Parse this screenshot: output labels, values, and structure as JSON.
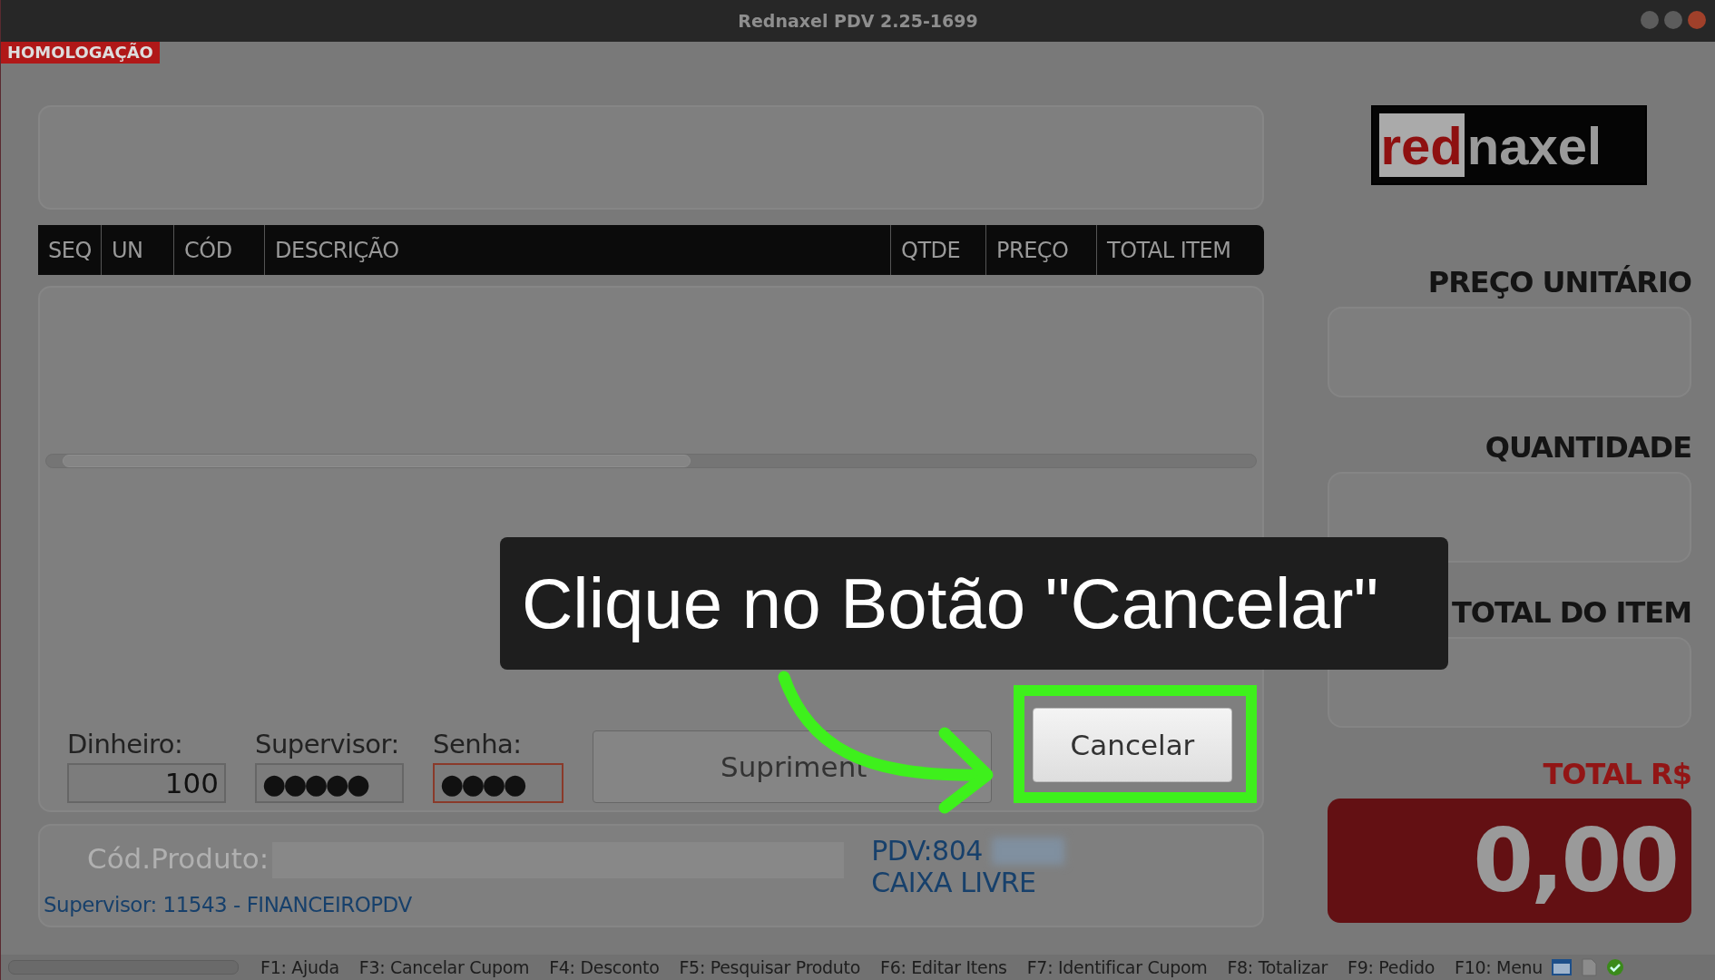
{
  "window": {
    "title": "Rednaxel PDV 2.25-1699"
  },
  "environment_badge": "HOMOLOGAÇÃO",
  "table": {
    "columns": [
      {
        "label": "SEQ"
      },
      {
        "label": "UN"
      },
      {
        "label": "CÓD"
      },
      {
        "label": "DESCRIÇÃO"
      },
      {
        "label": "QTDE"
      },
      {
        "label": "PREÇO"
      },
      {
        "label": "TOTAL ITEM"
      }
    ]
  },
  "form": {
    "fields": [
      {
        "label": "Dinheiro:",
        "value": "100",
        "focused": false
      },
      {
        "label": "Supervisor:",
        "value": "●●●●●",
        "focused": false
      },
      {
        "label": "Senha:",
        "value": "●●●●",
        "focused": true
      }
    ],
    "buttons": [
      {
        "label": "Supriment",
        "highlighted": false
      },
      {
        "label": "Cancelar",
        "highlighted": true
      }
    ]
  },
  "product_bar": {
    "label": "Cód.Produto:",
    "supervisor": "Supervisor: 11543 - FINANCEIROPDV",
    "pdv": "PDV:804",
    "status": "CAIXA LIVRE"
  },
  "logo": {
    "part_1": "red",
    "part_2": "naxel"
  },
  "summary": [
    {
      "label": "PREÇO UNITÁRIO"
    },
    {
      "label": "QUANTIDADE"
    },
    {
      "label": "TOTAL DO ITEM"
    }
  ],
  "total": {
    "label": "TOTAL R$",
    "value": "0,00"
  },
  "callout": {
    "text": "Clique no Botão \"Cancelar\""
  },
  "status_bar": {
    "progress": {
      "level": 0
    },
    "shortcuts": [
      "F1: Ajuda",
      "F3: Cancelar Cupom",
      "F4: Desconto",
      "F5: Pesquisar Produto",
      "F6: Editar Itens",
      "F7: Identificar Cupom",
      "F8: Totalizar",
      "F9: Pedido",
      "F10: Menu"
    ]
  }
}
